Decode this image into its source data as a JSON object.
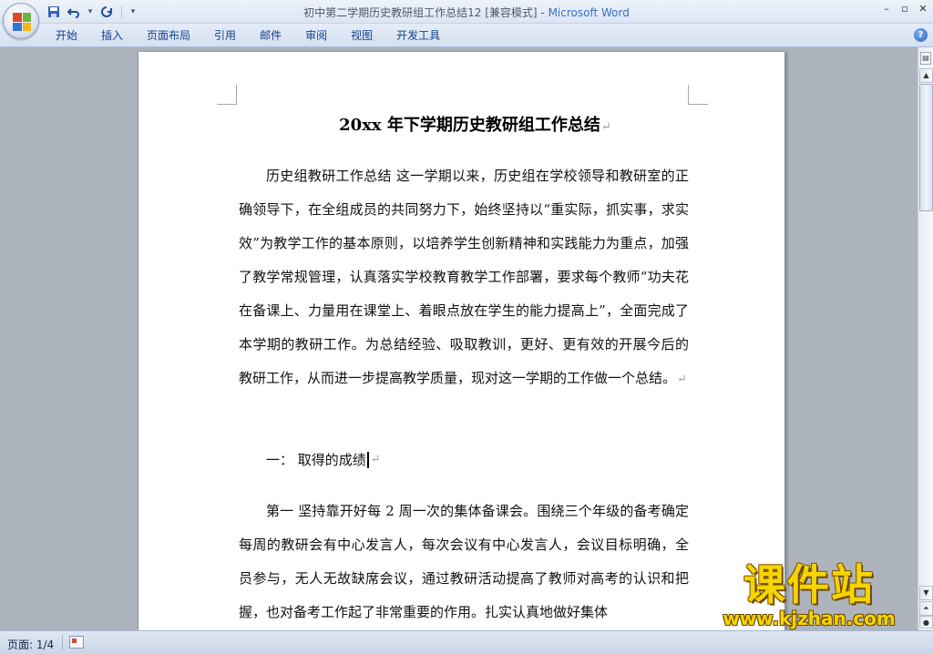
{
  "window": {
    "doc_title": "初中第二学期历史教研组工作总结12 [兼容模式]",
    "separator": " - ",
    "app_name": "Microsoft Word"
  },
  "ribbon_tabs": [
    "开始",
    "插入",
    "页面布局",
    "引用",
    "邮件",
    "审阅",
    "视图",
    "开发工具"
  ],
  "document": {
    "title": "20xx 年下学期历史教研组工作总结",
    "para1": "历史组教研工作总结 这一学期以来，历史组在学校领导和教研室的正确领导下，在全组成员的共同努力下，始终坚持以“重实际，抓实事，求实效”为教学工作的基本原则，以培养学生创新精神和实践能力为重点，加强了教学常规管理，认真落实学校教育教学工作部署，要求每个教师“功夫花在备课上、力量用在课堂上、着眼点放在学生的能力提高上”，全面完成了本学期的教研工作。为总结经验、吸取教训，更好、更有效的开展今后的教研工作，从而进一步提高教学质量，现对这一学期的工作做一个总结。",
    "heading1": "一： 取得的成绩",
    "para2": "第一 坚持靠开好每 2 周一次的集体备课会。围绕三个年级的备考确定每周的教研会有中心发言人，每次会议有中心发言人，会议目标明确，全员参与，无人无故缺席会议，通过教研活动提高了教师对高考的认识和把握，也对备考工作起了非常重要的作用。扎实认真地做好集体",
    "paragraph_mark": "↵"
  },
  "status": {
    "page": "页面: 1/4"
  },
  "watermark": {
    "title": "课件站",
    "url": "www.kjzhan.com"
  }
}
